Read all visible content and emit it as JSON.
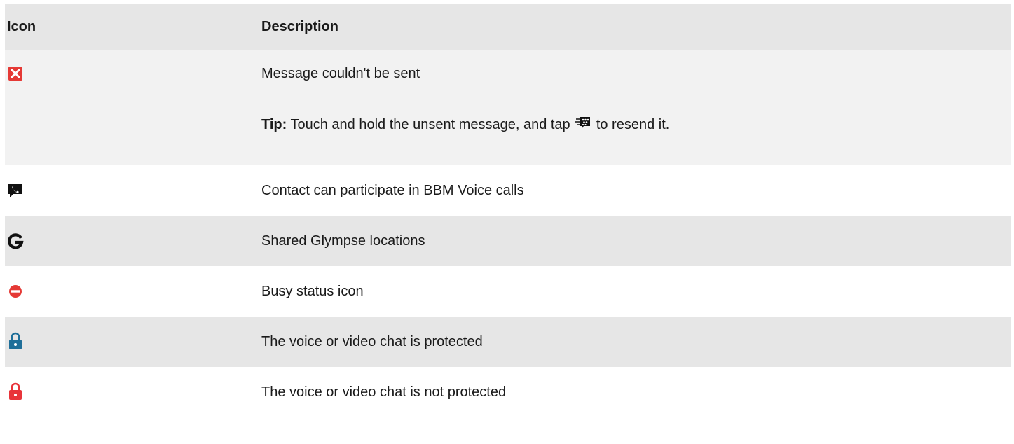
{
  "table": {
    "headers": {
      "icon": "Icon",
      "description": "Description"
    },
    "rows": [
      {
        "icon": "red-x-icon",
        "description": "Message couldn't be sent",
        "tip_label": "Tip:",
        "tip_before": "Touch and hold the unsent message, and tap",
        "tip_icon": "bbm-resend-icon",
        "tip_after": "to resend it."
      },
      {
        "icon": "bbm-voice-icon",
        "description": "Contact can participate in BBM Voice calls"
      },
      {
        "icon": "glympse-icon",
        "description": "Shared Glympse locations"
      },
      {
        "icon": "busy-status-icon",
        "description": "Busy status icon"
      },
      {
        "icon": "lock-protected-icon",
        "description": "The voice or video chat is protected"
      },
      {
        "icon": "lock-unprotected-icon",
        "description": "The voice or video chat is not protected"
      }
    ]
  },
  "colors": {
    "error_red": "#e53935",
    "protected_blue": "#1f6f99",
    "unprotected_red": "#e8343a",
    "header_bg": "#e6e6e6",
    "row_alt_bg": "#f2f2f2"
  }
}
